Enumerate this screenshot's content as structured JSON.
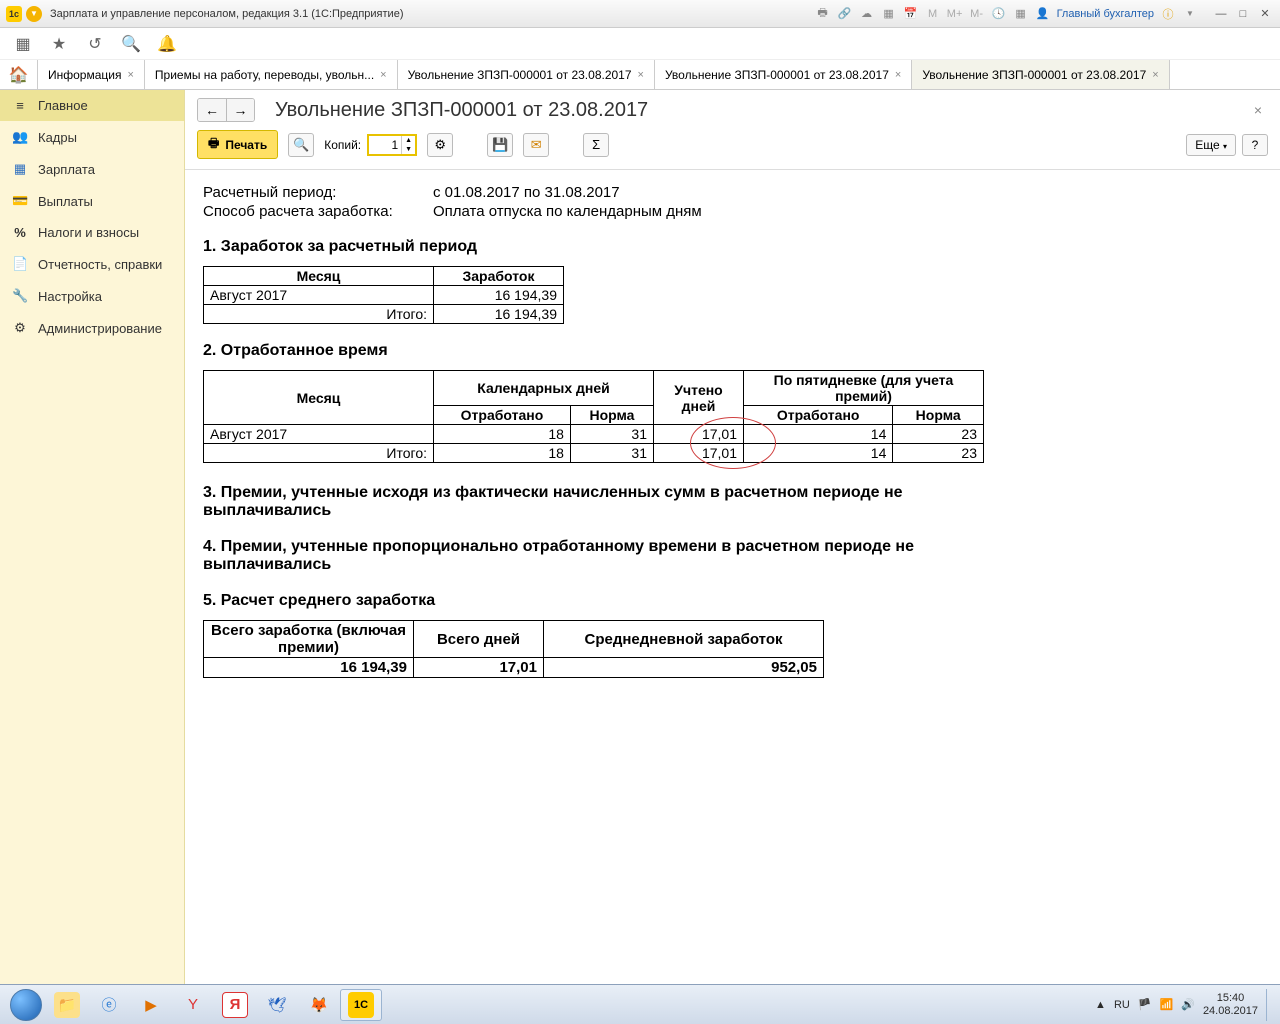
{
  "titlebar": {
    "app_title": "Зарплата и управление персоналом, редакция 3.1  (1С:Предприятие)",
    "user_label": "Главный бухгалтер"
  },
  "toprow_icons": [
    "apps",
    "star",
    "link",
    "search",
    "bell"
  ],
  "tabs": [
    {
      "label": "Информация"
    },
    {
      "label": "Приемы на работу, переводы, увольн..."
    },
    {
      "label": "Увольнение ЗПЗП-000001 от 23.08.2017"
    },
    {
      "label": "Увольнение ЗПЗП-000001 от 23.08.2017"
    },
    {
      "label": "Увольнение ЗПЗП-000001 от 23.08.2017",
      "active": true
    }
  ],
  "sidebar": [
    {
      "icon": "≡",
      "label": "Главное"
    },
    {
      "icon": "👥",
      "label": "Кадры"
    },
    {
      "icon": "▦",
      "label": "Зарплата"
    },
    {
      "icon": "💳",
      "label": "Выплаты"
    },
    {
      "icon": "%",
      "label": "Налоги и взносы"
    },
    {
      "icon": "📄",
      "label": "Отчетность, справки"
    },
    {
      "icon": "🔧",
      "label": "Настройка"
    },
    {
      "icon": "⚙",
      "label": "Администрирование"
    }
  ],
  "doc_title": "Увольнение ЗПЗП-000001 от 23.08.2017",
  "toolbar": {
    "print_label": "Печать",
    "copies_label": "Копий:",
    "copies_value": "1",
    "more_label": "Еще"
  },
  "info": {
    "period_label": "Расчетный период:",
    "period_value": "с 01.08.2017 по 31.08.2017",
    "method_label": "Способ расчета заработка:",
    "method_value": "Оплата отпуска по календарным дням"
  },
  "s1": {
    "heading": "1. Заработок за расчетный период",
    "cols": [
      "Месяц",
      "Заработок"
    ],
    "row": [
      "Август 2017",
      "16 194,39"
    ],
    "total_label": "Итого:",
    "total": "16 194,39"
  },
  "s2": {
    "heading": "2. Отработанное время",
    "h_month": "Месяц",
    "h_cal": "Календарных дней",
    "h_uch": "Учтено дней",
    "h_5": "По пятидневке (для учета премий)",
    "h_worked": "Отработано",
    "h_norm": "Норма",
    "row_month": "Август 2017",
    "row": [
      "18",
      "31",
      "17,01",
      "14",
      "23"
    ],
    "total_label": "Итого:",
    "total": [
      "18",
      "31",
      "17,01",
      "14",
      "23"
    ]
  },
  "s3": "3. Премии, учтенные исходя из фактически начисленных сумм в расчетном периоде не выплачивались",
  "s4": "4. Премии, учтенные пропорционально отработанному времени в расчетном периоде не выплачивались",
  "s5": {
    "heading": "5. Расчет среднего  заработка",
    "cols": [
      "Всего заработка (включая премии)",
      "Всего дней",
      "Среднедневной заработок"
    ],
    "vals": [
      "16 194,39",
      "17,01",
      "952,05"
    ]
  },
  "tray": {
    "lang": "RU",
    "time": "15:40",
    "date": "24.08.2017"
  }
}
